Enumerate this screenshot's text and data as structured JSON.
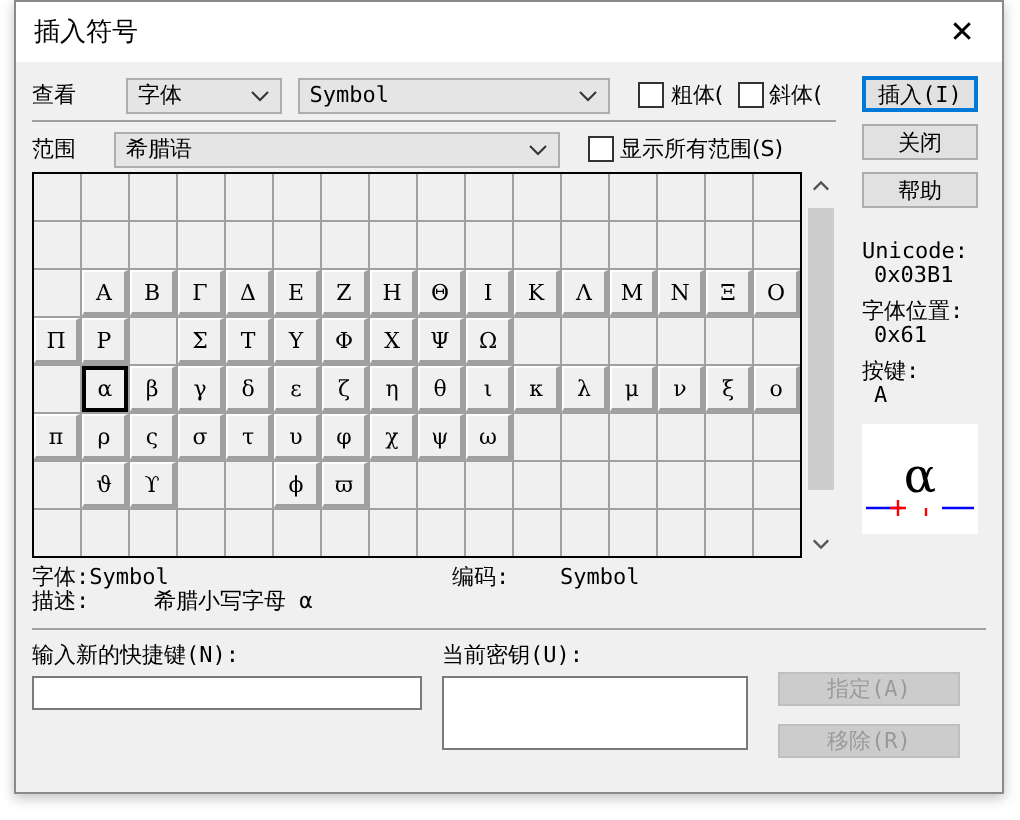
{
  "window": {
    "title": "插入符号",
    "close": "✕"
  },
  "view": {
    "label": "查看",
    "mode": "字体",
    "font": "Symbol"
  },
  "style_options": [
    {
      "label": "粗体(",
      "checked": false
    },
    {
      "label": "斜体(",
      "checked": false
    }
  ],
  "range": {
    "label": "范围",
    "value": "希腊语"
  },
  "show_all_ranges": {
    "label": "显示所有范围(S)",
    "checked": false
  },
  "buttons": [
    {
      "label": "插入(I)",
      "focused": true
    },
    {
      "label": "关闭",
      "focused": false
    },
    {
      "label": "帮助",
      "focused": false
    }
  ],
  "grid": {
    "rows": [
      [
        {
          "selected": false
        },
        {
          "selected": false
        },
        {
          "selected": false
        },
        {
          "selected": false
        },
        {
          "selected": false
        },
        {
          "selected": false
        },
        {
          "selected": false
        },
        {
          "selected": false
        },
        {
          "selected": false
        },
        {
          "selected": false
        },
        {
          "selected": false
        },
        {
          "selected": false
        },
        {
          "selected": false
        },
        {
          "selected": false
        },
        {
          "selected": false
        },
        {
          "selected": false
        }
      ],
      [
        {
          "selected": false
        },
        {
          "selected": false
        },
        {
          "selected": false
        },
        {
          "selected": false
        },
        {
          "selected": false
        },
        {
          "selected": false
        },
        {
          "selected": false
        },
        {
          "selected": false
        },
        {
          "selected": false
        },
        {
          "selected": false
        },
        {
          "selected": false
        },
        {
          "selected": false
        },
        {
          "selected": false
        },
        {
          "selected": false
        },
        {
          "selected": false
        },
        {
          "selected": false
        }
      ],
      [
        {
          "selected": false
        },
        {
          "c": "Α",
          "selected": false
        },
        {
          "c": "Β",
          "selected": false
        },
        {
          "c": "Γ",
          "selected": false
        },
        {
          "c": "Δ",
          "selected": false
        },
        {
          "c": "Ε",
          "selected": false
        },
        {
          "c": "Ζ",
          "selected": false
        },
        {
          "c": "Η",
          "selected": false
        },
        {
          "c": "Θ",
          "selected": false
        },
        {
          "c": "Ι",
          "selected": false
        },
        {
          "c": "Κ",
          "selected": false
        },
        {
          "c": "Λ",
          "selected": false
        },
        {
          "c": "Μ",
          "selected": false
        },
        {
          "c": "Ν",
          "selected": false
        },
        {
          "c": "Ξ",
          "selected": false
        },
        {
          "c": "Ο",
          "selected": false
        }
      ],
      [
        {
          "c": "Π",
          "selected": false
        },
        {
          "c": "Ρ",
          "selected": false
        },
        {
          "selected": false
        },
        {
          "c": "Σ",
          "selected": false
        },
        {
          "c": "Τ",
          "selected": false
        },
        {
          "c": "Υ",
          "selected": false
        },
        {
          "c": "Φ",
          "selected": false
        },
        {
          "c": "Χ",
          "selected": false
        },
        {
          "c": "Ψ",
          "selected": false
        },
        {
          "c": "Ω",
          "selected": false
        },
        {
          "selected": false
        },
        {
          "selected": false
        },
        {
          "selected": false
        },
        {
          "selected": false
        },
        {
          "selected": false
        },
        {
          "selected": false
        }
      ],
      [
        {
          "selected": false
        },
        {
          "c": "α",
          "selected": true
        },
        {
          "c": "β",
          "selected": false
        },
        {
          "c": "γ",
          "selected": false
        },
        {
          "c": "δ",
          "selected": false
        },
        {
          "c": "ε",
          "selected": false
        },
        {
          "c": "ζ",
          "selected": false
        },
        {
          "c": "η",
          "selected": false
        },
        {
          "c": "θ",
          "selected": false
        },
        {
          "c": "ι",
          "selected": false
        },
        {
          "c": "κ",
          "selected": false
        },
        {
          "c": "λ",
          "selected": false
        },
        {
          "c": "μ",
          "selected": false
        },
        {
          "c": "ν",
          "selected": false
        },
        {
          "c": "ξ",
          "selected": false
        },
        {
          "c": "ο",
          "selected": false
        }
      ],
      [
        {
          "c": "π",
          "selected": false
        },
        {
          "c": "ρ",
          "selected": false
        },
        {
          "c": "ς",
          "selected": false
        },
        {
          "c": "σ",
          "selected": false
        },
        {
          "c": "τ",
          "selected": false
        },
        {
          "c": "υ",
          "selected": false
        },
        {
          "c": "φ",
          "selected": false
        },
        {
          "c": "χ",
          "selected": false
        },
        {
          "c": "ψ",
          "selected": false
        },
        {
          "c": "ω",
          "selected": false
        },
        {
          "selected": false
        },
        {
          "selected": false
        },
        {
          "selected": false
        },
        {
          "selected": false
        },
        {
          "selected": false
        },
        {
          "selected": false
        }
      ],
      [
        {
          "selected": false
        },
        {
          "c": "ϑ",
          "selected": false
        },
        {
          "c": "ϒ",
          "selected": false
        },
        {
          "selected": false
        },
        {
          "selected": false
        },
        {
          "c": "ϕ",
          "selected": false
        },
        {
          "c": "ϖ",
          "selected": false
        },
        {
          "selected": false
        },
        {
          "selected": false
        },
        {
          "selected": false
        },
        {
          "selected": false
        },
        {
          "selected": false
        },
        {
          "selected": false
        },
        {
          "selected": false
        },
        {
          "selected": false
        },
        {
          "selected": false
        }
      ],
      [
        {
          "selected": false
        },
        {
          "selected": false
        },
        {
          "selected": false
        },
        {
          "selected": false
        },
        {
          "selected": false
        },
        {
          "selected": false
        },
        {
          "selected": false
        },
        {
          "selected": false
        },
        {
          "selected": false
        },
        {
          "selected": false
        },
        {
          "selected": false
        },
        {
          "selected": false
        },
        {
          "selected": false
        },
        {
          "selected": false
        },
        {
          "selected": false
        },
        {
          "selected": false
        }
      ]
    ]
  },
  "info": [
    {
      "label": "Unicode:",
      "value": "0x03B1"
    },
    {
      "label": "字体位置:",
      "value": "0x61"
    },
    {
      "label": "按键:",
      "value": "A"
    }
  ],
  "preview": {
    "char": "α"
  },
  "font_line": "字体:Symbol",
  "encoding": {
    "label": "编码:",
    "value": "Symbol"
  },
  "description": {
    "label": "描述:",
    "value": "希腊小写字母 α"
  },
  "shortcut": {
    "label": "输入新的快捷键(N):"
  },
  "current_keys": {
    "label": "当前密钥(U):"
  },
  "key_buttons": [
    {
      "label": "指定(A)",
      "disabled": true
    },
    {
      "label": "移除(R)",
      "disabled": true
    }
  ]
}
